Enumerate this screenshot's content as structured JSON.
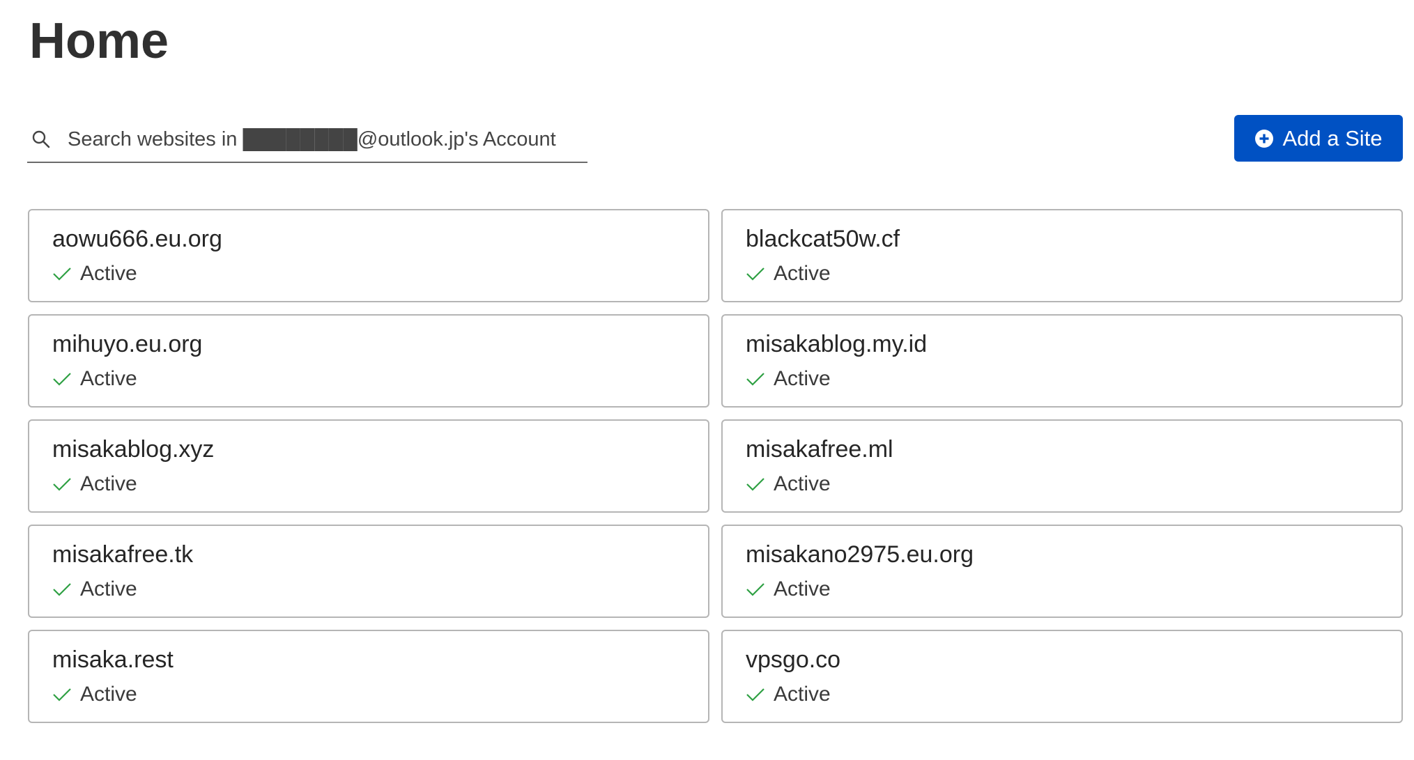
{
  "page": {
    "title": "Home"
  },
  "search": {
    "placeholder": "Search websites in ████████@outlook.jp's Account",
    "icon": "search-icon"
  },
  "toolbar": {
    "add_site_label": "Add a Site",
    "add_site_icon": "plus-circle-icon"
  },
  "colors": {
    "accent": "#0051c3",
    "status_active": "#2ea043",
    "card_border": "#b5b5b5"
  },
  "sites": [
    {
      "name": "aowu666.eu.org",
      "status": "Active"
    },
    {
      "name": "blackcat50w.cf",
      "status": "Active"
    },
    {
      "name": "mihuyo.eu.org",
      "status": "Active"
    },
    {
      "name": "misakablog.my.id",
      "status": "Active"
    },
    {
      "name": "misakablog.xyz",
      "status": "Active"
    },
    {
      "name": "misakafree.ml",
      "status": "Active"
    },
    {
      "name": "misakafree.tk",
      "status": "Active"
    },
    {
      "name": "misakano2975.eu.org",
      "status": "Active"
    },
    {
      "name": "misaka.rest",
      "status": "Active"
    },
    {
      "name": "vpsgo.co",
      "status": "Active"
    }
  ]
}
